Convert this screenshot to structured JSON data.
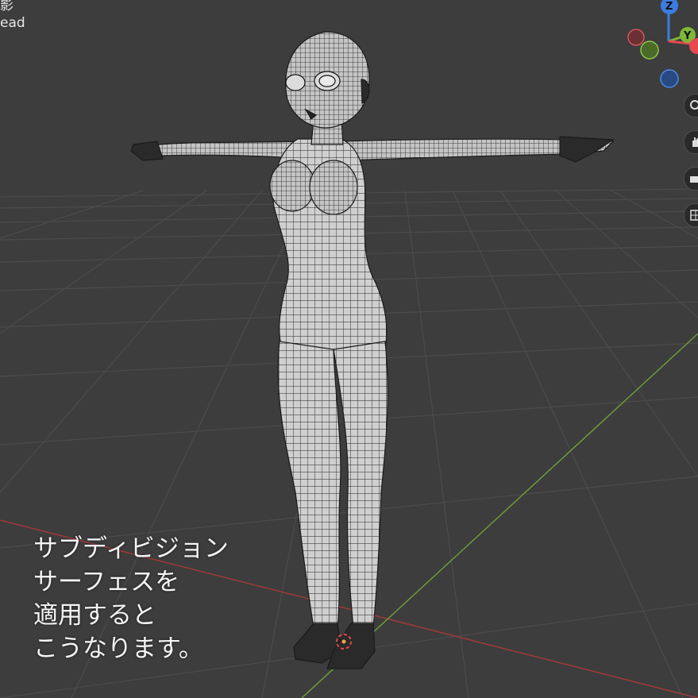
{
  "viewport": {
    "overlay_line1": "影",
    "overlay_line2": "ead"
  },
  "gizmo": {
    "z_label": "Z",
    "y_label": "Y",
    "colors": {
      "x": "#e8474f",
      "y": "#7fb838",
      "z": "#3d7ce0",
      "x_neg": "#8a3a3e",
      "y_neg": "#5f7a3a",
      "z_neg": "#2f5694"
    }
  },
  "toolbar": {
    "icons": [
      "zoom-icon",
      "hand-icon",
      "camera-icon",
      "grid-icon"
    ]
  },
  "caption": {
    "line1": "サブディビジョン",
    "line2": "サーフェスを",
    "line3": "適用すると",
    "line4": "こうなります。"
  },
  "colors": {
    "background": "#3d3d3d",
    "grid": "#4a4a4a",
    "axis_x": "#a03a3a",
    "axis_y": "#6f9a3a",
    "mesh_fill": "#c9c9c9",
    "mesh_wire": "#1a1a1a"
  }
}
